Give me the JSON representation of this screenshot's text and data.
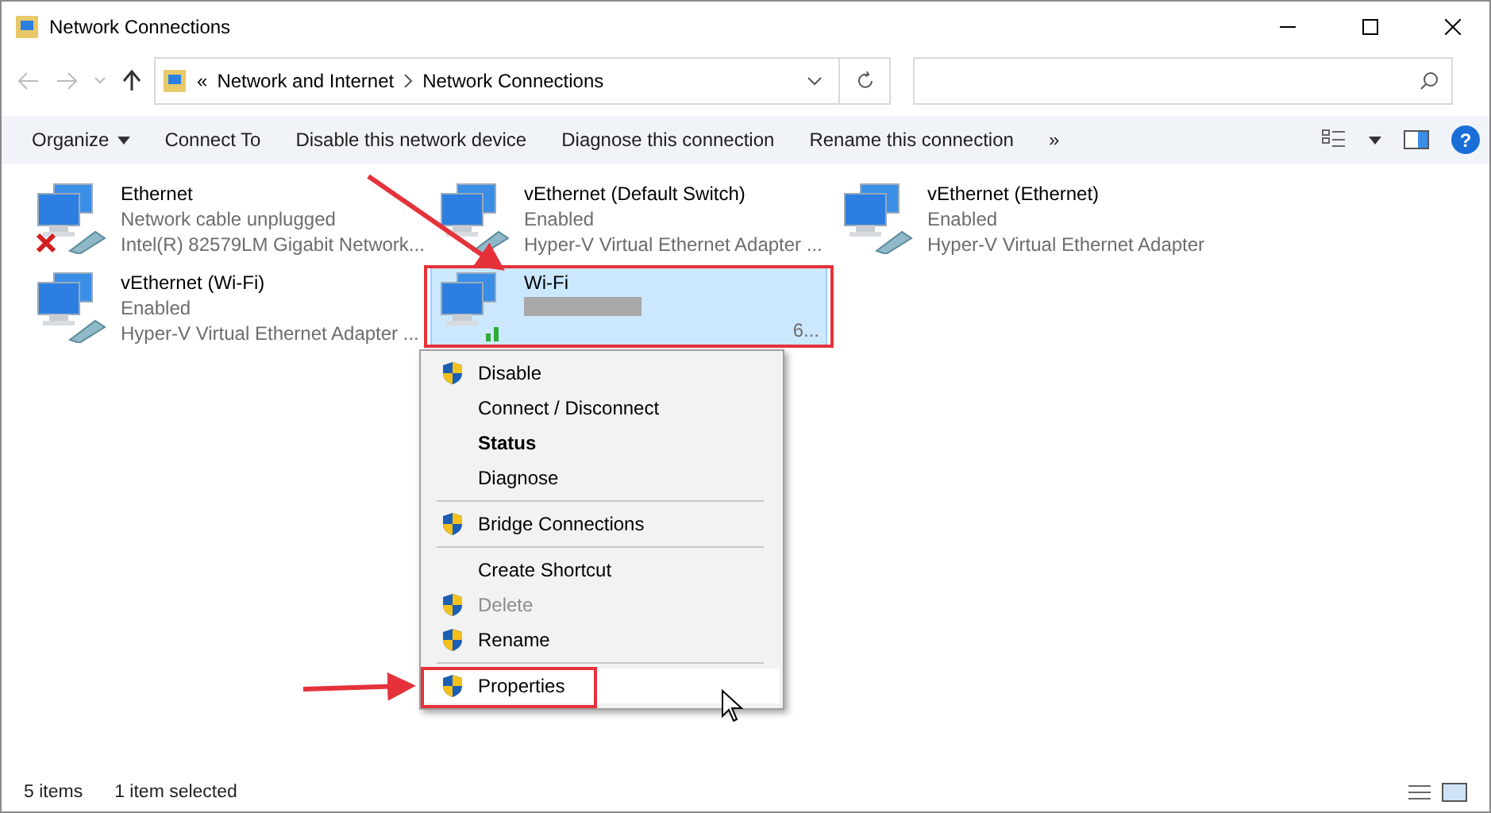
{
  "window": {
    "title": "Network Connections"
  },
  "address_bar": {
    "overflow": "«",
    "path": [
      "Network and Internet",
      "Network Connections"
    ]
  },
  "toolbar": {
    "help": "?",
    "items": [
      {
        "label": "Organize",
        "dropdown": true
      },
      {
        "label": "Connect To",
        "dropdown": false
      },
      {
        "label": "Disable this network device",
        "dropdown": false
      },
      {
        "label": "Diagnose this connection",
        "dropdown": false
      },
      {
        "label": "Rename this connection",
        "dropdown": false
      },
      {
        "label": "»",
        "dropdown": false
      }
    ]
  },
  "connections": [
    {
      "name": "Ethernet",
      "status": "Network cable unplugged",
      "device": "Intel(R) 82579LM Gigabit Network...",
      "kind": "unplugged",
      "selected": false
    },
    {
      "name": "vEthernet (Default Switch)",
      "status": "Enabled",
      "device": "Hyper-V Virtual Ethernet Adapter ...",
      "kind": "cable",
      "selected": false
    },
    {
      "name": "vEthernet (Ethernet)",
      "status": "Enabled",
      "device": "Hyper-V Virtual Ethernet Adapter",
      "kind": "cable",
      "selected": false
    },
    {
      "name": "vEthernet (Wi-Fi)",
      "status": "Enabled",
      "device": "Hyper-V Virtual Ethernet Adapter ...",
      "kind": "cable",
      "selected": false
    },
    {
      "name": "Wi-Fi",
      "status_redacted": true,
      "device": "6...",
      "kind": "wireless",
      "selected": true
    }
  ],
  "context_menu": {
    "groups": [
      [
        {
          "label": "Disable",
          "shield": true,
          "bold": false,
          "disabled": false,
          "highlighted": false
        },
        {
          "label": "Connect / Disconnect",
          "shield": false,
          "bold": false,
          "disabled": false,
          "highlighted": false
        },
        {
          "label": "Status",
          "shield": false,
          "bold": true,
          "disabled": false,
          "highlighted": false
        },
        {
          "label": "Diagnose",
          "shield": false,
          "bold": false,
          "disabled": false,
          "highlighted": false
        }
      ],
      [
        {
          "label": "Bridge Connections",
          "shield": true,
          "bold": false,
          "disabled": false,
          "highlighted": false
        }
      ],
      [
        {
          "label": "Create Shortcut",
          "shield": false,
          "bold": false,
          "disabled": false,
          "highlighted": false
        },
        {
          "label": "Delete",
          "shield": true,
          "bold": false,
          "disabled": true,
          "highlighted": false
        },
        {
          "label": "Rename",
          "shield": true,
          "bold": false,
          "disabled": false,
          "highlighted": false
        }
      ],
      [
        {
          "label": "Properties",
          "shield": true,
          "bold": false,
          "disabled": false,
          "highlighted": true
        }
      ]
    ]
  },
  "status_bar": {
    "count": "5 items",
    "selection": "1 item selected"
  }
}
